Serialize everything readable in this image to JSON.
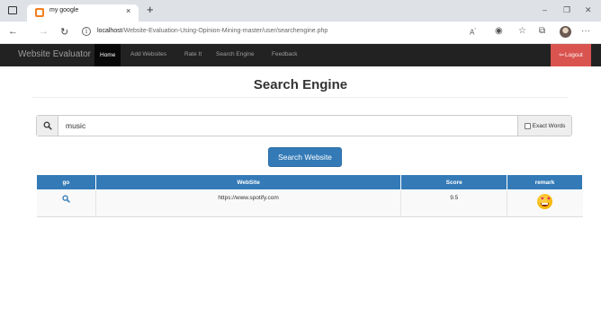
{
  "browser": {
    "tab_title": "my google",
    "tab_close": "×",
    "new_tab": "+",
    "url_host": "localhost",
    "url_path": "/Website-Evaluation-Using-Opinion-Mining-master/user/searchengine.php",
    "icons": [
      "back-icon",
      "forward-icon",
      "refresh-icon",
      "info-icon",
      "read-aloud-icon",
      "extension-icon",
      "favorites-icon",
      "collections-icon",
      "profile-avatar",
      "more-icon"
    ]
  },
  "navbar": {
    "brand": "Website Evaluator",
    "items": [
      {
        "label": "Home",
        "active": true
      },
      {
        "label": "Add Websites"
      },
      {
        "label": "Rate It"
      },
      {
        "label": "Search Engine"
      },
      {
        "label": "Feedback"
      }
    ],
    "logout": "Logout"
  },
  "page": {
    "title": "Search Engine",
    "search_value": "music",
    "exact_label": "Exact Words",
    "exact_checked": false,
    "search_button": "Search Website"
  },
  "table": {
    "headers": [
      "go",
      "WebSite",
      "Score",
      "remark"
    ],
    "rows": [
      {
        "go_icon": "search-icon",
        "website": "https://www.spotify.com",
        "score": "9.5",
        "remark_icon": "heart-eyes-emoji"
      }
    ]
  },
  "colors": {
    "navbar_bg": "#222222",
    "primary": "#337ab7",
    "logout": "#d9534f"
  }
}
